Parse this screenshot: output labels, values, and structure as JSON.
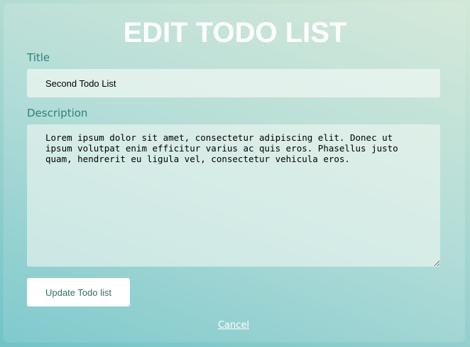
{
  "page": {
    "title": "EDIT TODO LIST"
  },
  "form": {
    "title_label": "Title",
    "title_value": "Second Todo List",
    "description_label": "Description",
    "description_value": "Lorem ipsum dolor sit amet, consectetur adipiscing elit. Donec ut ipsum volutpat enim efficitur varius ac quis eros. Phasellus justo quam, hendrerit eu ligula vel, consectetur vehicula eros.",
    "submit_label": "Update Todo list",
    "cancel_label": "Cancel"
  },
  "colors": {
    "label": "#2f8078",
    "button_text": "#2f6f6a",
    "heading": "#ffffff"
  }
}
